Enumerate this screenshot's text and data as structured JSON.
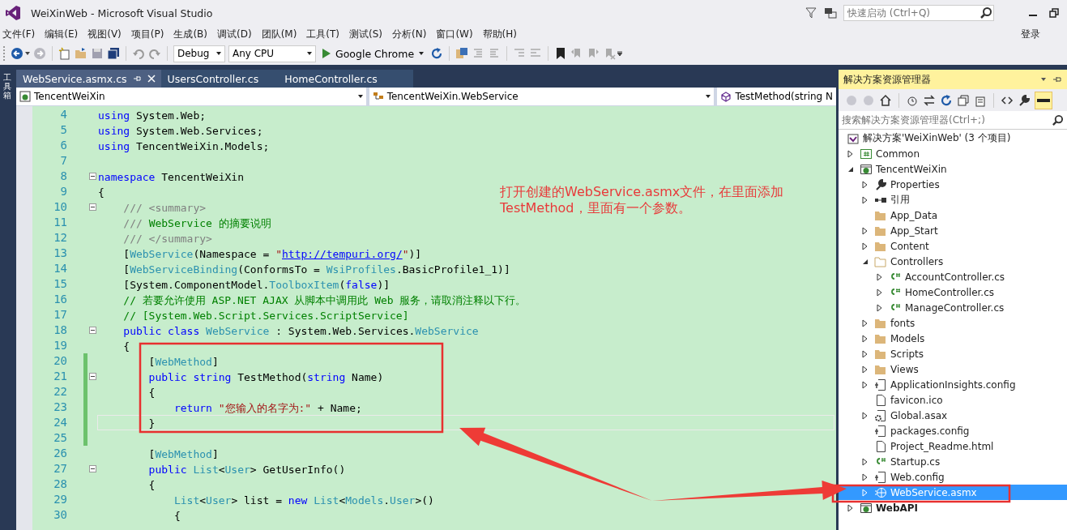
{
  "window": {
    "title": "WeiXinWeb - Microsoft Visual Studio",
    "quick_launch": {
      "placeholder": "快速启动 (Ctrl+Q)"
    }
  },
  "menu": [
    "文件(F)",
    "编辑(E)",
    "视图(V)",
    "项目(P)",
    "生成(B)",
    "调试(D)",
    "团队(M)",
    "工具(T)",
    "测试(S)",
    "分析(N)",
    "窗口(W)",
    "帮助(H)"
  ],
  "sign_in": "登录",
  "toolbar": {
    "configuration": "Debug",
    "platform": "Any CPU",
    "browser": "Google Chrome"
  },
  "toolbox": {
    "label": "工具箱"
  },
  "tabs": [
    {
      "label": "WebService.asmx.cs",
      "selected": true
    },
    {
      "label": "UsersController.cs",
      "selected": false
    },
    {
      "label": "HomeController.cs",
      "selected": false
    }
  ],
  "nav": [
    {
      "kind": "project",
      "label": "TencentWeiXin"
    },
    {
      "kind": "class",
      "label": "TencentWeiXin.WebService"
    },
    {
      "kind": "method",
      "label": "TestMethod(string N"
    }
  ],
  "code": {
    "lines": [
      {
        "n": "4",
        "fold": false,
        "changed": false,
        "current": false,
        "tokens": [
          {
            "kind": "kw",
            "text": "using"
          },
          {
            "kind": "plain",
            "text": " System.Web;"
          }
        ]
      },
      {
        "n": "5",
        "fold": false,
        "changed": false,
        "current": false,
        "tokens": [
          {
            "kind": "kw",
            "text": "using"
          },
          {
            "kind": "plain",
            "text": " System.Web.Services;"
          }
        ]
      },
      {
        "n": "6",
        "fold": false,
        "changed": false,
        "current": false,
        "tokens": [
          {
            "kind": "kw",
            "text": "using"
          },
          {
            "kind": "plain",
            "text": " TencentWeiXin.Models;"
          }
        ]
      },
      {
        "n": "7",
        "fold": false,
        "changed": false,
        "current": false
      },
      {
        "n": "8",
        "fold": true,
        "changed": false,
        "current": false,
        "tokens": [
          {
            "kind": "kw",
            "text": "namespace"
          },
          {
            "kind": "plain",
            "text": " TencentWeiXin"
          }
        ]
      },
      {
        "n": "9",
        "fold": false,
        "changed": false,
        "current": false,
        "tokens": [
          {
            "kind": "plain",
            "text": "{"
          }
        ]
      },
      {
        "n": "10",
        "fold": true,
        "changed": false,
        "current": false,
        "tokens": [
          {
            "kind": "doc",
            "text": "    /// <summary>"
          }
        ]
      },
      {
        "n": "11",
        "fold": false,
        "changed": false,
        "current": false,
        "tokens": [
          {
            "kind": "doc",
            "text": "    /// "
          },
          {
            "kind": "cmt",
            "text": "WebService 的摘要说明"
          }
        ]
      },
      {
        "n": "12",
        "fold": false,
        "changed": false,
        "current": false,
        "tokens": [
          {
            "kind": "doc",
            "text": "    /// </summary>"
          }
        ]
      },
      {
        "n": "13",
        "fold": false,
        "changed": false,
        "current": false,
        "tokens": [
          {
            "kind": "plain",
            "text": "    ["
          },
          {
            "kind": "type",
            "text": "WebService"
          },
          {
            "kind": "plain",
            "text": "(Namespace = "
          },
          {
            "kind": "str",
            "text": "\""
          },
          {
            "kind": "url",
            "text": "http://tempuri.org/"
          },
          {
            "kind": "str",
            "text": "\""
          },
          {
            "kind": "plain",
            "text": ")]"
          }
        ]
      },
      {
        "n": "14",
        "fold": false,
        "changed": false,
        "current": false,
        "tokens": [
          {
            "kind": "plain",
            "text": "    ["
          },
          {
            "kind": "type",
            "text": "WebServiceBinding"
          },
          {
            "kind": "plain",
            "text": "(ConformsTo = "
          },
          {
            "kind": "type",
            "text": "WsiProfiles"
          },
          {
            "kind": "plain",
            "text": ".BasicProfile1_1)]"
          }
        ]
      },
      {
        "n": "15",
        "fold": false,
        "changed": false,
        "current": false,
        "tokens": [
          {
            "kind": "plain",
            "text": "    [System.ComponentModel."
          },
          {
            "kind": "type",
            "text": "ToolboxItem"
          },
          {
            "kind": "plain",
            "text": "("
          },
          {
            "kind": "kw",
            "text": "false"
          },
          {
            "kind": "plain",
            "text": ")]"
          }
        ]
      },
      {
        "n": "16",
        "fold": false,
        "changed": false,
        "current": false,
        "tokens": [
          {
            "kind": "cmt",
            "text": "    // 若要允许使用 ASP.NET AJAX 从脚本中调用此 Web 服务，请取消注释以下行。"
          }
        ]
      },
      {
        "n": "17",
        "fold": false,
        "changed": false,
        "current": false,
        "tokens": [
          {
            "kind": "cmt",
            "text": "    // [System.Web.Script.Services.ScriptService]"
          }
        ]
      },
      {
        "n": "18",
        "fold": true,
        "changed": false,
        "current": false,
        "tokens": [
          {
            "kind": "kw",
            "text": "    public class "
          },
          {
            "kind": "type",
            "text": "WebService"
          },
          {
            "kind": "plain",
            "text": " : System.Web.Services."
          },
          {
            "kind": "type",
            "text": "WebService"
          }
        ]
      },
      {
        "n": "19",
        "fold": false,
        "changed": false,
        "current": false,
        "tokens": [
          {
            "kind": "plain",
            "text": "    {"
          }
        ]
      },
      {
        "n": "20",
        "fold": false,
        "changed": true,
        "current": false,
        "tokens": [
          {
            "kind": "plain",
            "text": "        ["
          },
          {
            "kind": "type",
            "text": "WebMethod"
          },
          {
            "kind": "plain",
            "text": "]"
          }
        ]
      },
      {
        "n": "21",
        "fold": true,
        "changed": true,
        "current": false,
        "tokens": [
          {
            "kind": "kw",
            "text": "        public string"
          },
          {
            "kind": "plain",
            "text": " TestMethod("
          },
          {
            "kind": "kw",
            "text": "string"
          },
          {
            "kind": "plain",
            "text": " Name)"
          }
        ]
      },
      {
        "n": "22",
        "fold": false,
        "changed": true,
        "current": false,
        "tokens": [
          {
            "kind": "plain",
            "text": "        {"
          }
        ]
      },
      {
        "n": "23",
        "fold": false,
        "changed": true,
        "current": false,
        "tokens": [
          {
            "kind": "kw",
            "text": "            return "
          },
          {
            "kind": "str",
            "text": "\"您输入的名字为:\""
          },
          {
            "kind": "plain",
            "text": " + Name;"
          }
        ]
      },
      {
        "n": "24",
        "fold": false,
        "changed": true,
        "current": true,
        "tokens": [
          {
            "kind": "plain",
            "text": "        }"
          }
        ]
      },
      {
        "n": "25",
        "fold": false,
        "changed": true,
        "current": false
      },
      {
        "n": "26",
        "fold": false,
        "changed": false,
        "current": false,
        "tokens": [
          {
            "kind": "plain",
            "text": "        ["
          },
          {
            "kind": "type",
            "text": "WebMethod"
          },
          {
            "kind": "plain",
            "text": "]"
          }
        ]
      },
      {
        "n": "27",
        "fold": true,
        "changed": false,
        "current": false,
        "tokens": [
          {
            "kind": "kw",
            "text": "        public "
          },
          {
            "kind": "type",
            "text": "List"
          },
          {
            "kind": "plain",
            "text": "<"
          },
          {
            "kind": "type",
            "text": "User"
          },
          {
            "kind": "plain",
            "text": "> GetUserInfo()"
          }
        ]
      },
      {
        "n": "28",
        "fold": false,
        "changed": false,
        "current": false,
        "tokens": [
          {
            "kind": "plain",
            "text": "        {"
          }
        ]
      },
      {
        "n": "29",
        "fold": false,
        "changed": false,
        "current": false,
        "tokens": [
          {
            "kind": "type",
            "text": "            List"
          },
          {
            "kind": "plain",
            "text": "<"
          },
          {
            "kind": "type",
            "text": "User"
          },
          {
            "kind": "plain",
            "text": "> list = "
          },
          {
            "kind": "kw",
            "text": "new "
          },
          {
            "kind": "type",
            "text": "List"
          },
          {
            "kind": "plain",
            "text": "<"
          },
          {
            "kind": "type",
            "text": "Models"
          },
          {
            "kind": "plain",
            "text": "."
          },
          {
            "kind": "type",
            "text": "User"
          },
          {
            "kind": "plain",
            "text": ">()"
          }
        ]
      },
      {
        "n": "30",
        "fold": false,
        "changed": false,
        "current": false,
        "tokens": [
          {
            "kind": "plain",
            "text": "            {"
          }
        ]
      }
    ]
  },
  "annotation": {
    "lines": [
      "打开创建的WebService.asmx文件，在里面添加",
      "TestMethod，里面有一个参数。"
    ]
  },
  "explorer": {
    "title": "解决方案资源管理器",
    "search": {
      "placeholder": "搜索解决方案资源管理器(Ctrl+;)"
    },
    "tree": [
      {
        "label": "解决方案'WeiXinWeb' (3 个项目)",
        "kind": "solution",
        "selected": false,
        "children": [
          {
            "label": "Common",
            "kind": "csproj",
            "selected": false,
            "expanded": false,
            "startup": false
          },
          {
            "label": "TencentWeiXin",
            "kind": "webproj",
            "selected": false,
            "expanded": true,
            "startup": false,
            "children": [
              {
                "label": "Properties",
                "kind": "properties",
                "selected": false,
                "expanded": false
              },
              {
                "label": "引用",
                "kind": "references",
                "selected": false,
                "expanded": false
              },
              {
                "label": "App_Data",
                "kind": "folder",
                "selected": false
              },
              {
                "label": "App_Start",
                "kind": "folder",
                "selected": false,
                "expanded": false
              },
              {
                "label": "Content",
                "kind": "folder",
                "selected": false,
                "expanded": false
              },
              {
                "label": "Controllers",
                "kind": "folder",
                "selected": false,
                "expanded": true,
                "children": [
                  {
                    "label": "AccountController.cs",
                    "kind": "csfile",
                    "selected": false,
                    "expanded": false
                  },
                  {
                    "label": "HomeController.cs",
                    "kind": "csfile",
                    "selected": false,
                    "expanded": false
                  },
                  {
                    "label": "ManageController.cs",
                    "kind": "csfile",
                    "selected": false,
                    "expanded": false
                  }
                ]
              },
              {
                "label": "fonts",
                "kind": "folder",
                "selected": false,
                "expanded": false
              },
              {
                "label": "Models",
                "kind": "folder",
                "selected": false,
                "expanded": false
              },
              {
                "label": "Scripts",
                "kind": "folder",
                "selected": false,
                "expanded": false
              },
              {
                "label": "Views",
                "kind": "folder",
                "selected": false,
                "expanded": false
              },
              {
                "label": "ApplicationInsights.config",
                "kind": "config",
                "selected": false,
                "expanded": false
              },
              {
                "label": "favicon.ico",
                "kind": "doc",
                "selected": false
              },
              {
                "label": "Global.asax",
                "kind": "asax",
                "selected": false,
                "expanded": false
              },
              {
                "label": "packages.config",
                "kind": "config",
                "selected": false
              },
              {
                "label": "Project_Readme.html",
                "kind": "doc",
                "selected": false
              },
              {
                "label": "Startup.cs",
                "kind": "csfile",
                "selected": false,
                "expanded": false
              },
              {
                "label": "Web.config",
                "kind": "config",
                "selected": false,
                "expanded": false
              },
              {
                "label": "WebService.asmx",
                "kind": "asmx",
                "selected": true,
                "expanded": false
              }
            ]
          },
          {
            "label": "WebAPI",
            "kind": "webproj",
            "selected": false,
            "expanded": false,
            "startup": true
          }
        ]
      }
    ]
  }
}
